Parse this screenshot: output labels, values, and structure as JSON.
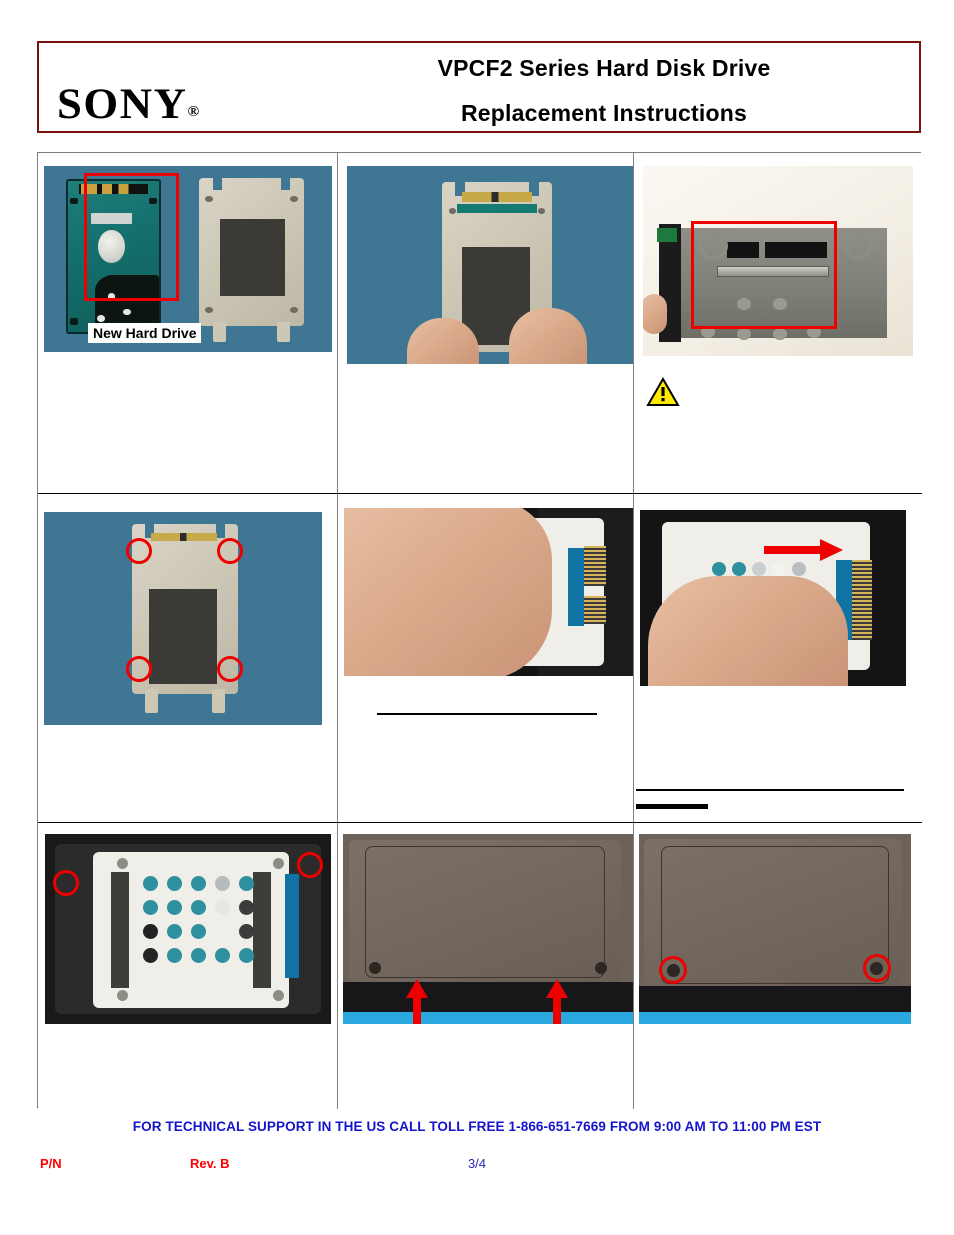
{
  "document": {
    "brand": "SONY",
    "brand_registered_mark": "®",
    "title_line1": "VPCF2 Series Hard Disk Drive",
    "title_line2": "Replacement Instructions",
    "header_border_color": "#7b1010"
  },
  "steps": [
    {
      "id": "step-1",
      "scene": "new-hard-drive-and-bracket",
      "callout_label": "New Hard Drive",
      "annotations": [
        "red-box",
        "callout-label"
      ],
      "caption": ""
    },
    {
      "id": "step-2",
      "scene": "hands-holding-drive-with-bracket",
      "annotations": [],
      "caption": ""
    },
    {
      "id": "step-3",
      "scene": "sata-connector-closeup",
      "annotations": [
        "red-box",
        "warning-triangle"
      ],
      "warning_icon": "warning-triangle-icon",
      "caption": ""
    },
    {
      "id": "step-4",
      "scene": "bracket-screw-locations",
      "annotations": [
        "red-circle",
        "red-circle",
        "red-circle",
        "red-circle"
      ],
      "caption": ""
    },
    {
      "id": "step-5",
      "scene": "hand-inserting-drive-into-bay",
      "annotations": [
        "caption-rule"
      ],
      "caption": ""
    },
    {
      "id": "step-6",
      "scene": "hand-sliding-drive-into-connector",
      "annotations": [
        "red-arrow-right",
        "caption-rule",
        "caption-rule-short"
      ],
      "caption": ""
    },
    {
      "id": "step-7",
      "scene": "drive-installed-in-bay",
      "annotations": [
        "red-circle",
        "red-circle"
      ],
      "caption": ""
    },
    {
      "id": "step-8",
      "scene": "bottom-cover-alignment",
      "annotations": [
        "red-arrow-up",
        "red-arrow-up"
      ],
      "caption": ""
    },
    {
      "id": "step-9",
      "scene": "bottom-cover-screws",
      "annotations": [
        "red-circle",
        "red-circle"
      ],
      "caption": ""
    }
  ],
  "footer": {
    "support": "FOR TECHNICAL SUPPORT IN THE US CALL TOLL FREE 1-866-651-7669 FROM 9:00 AM TO 11:00 PM EST",
    "support_color": "#1414cd",
    "part_number_label": "P/N",
    "revision_label": "Rev. B",
    "label_color": "#fe0000",
    "page_number": "3/4",
    "page_number_color": "#2a2ab5"
  },
  "colors": {
    "annotation_red": "#ee0000",
    "warning_yellow": "#ffe800",
    "photo_blue_background": "#3f7493"
  }
}
